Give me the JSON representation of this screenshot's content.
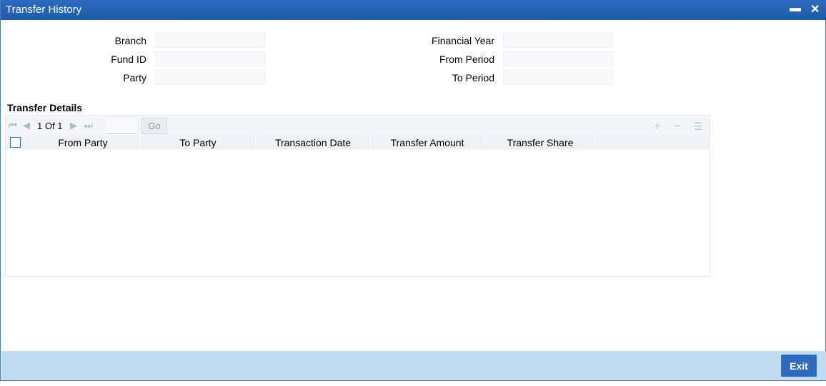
{
  "window": {
    "title": "Transfer History",
    "minimize_icon": "minimize-icon",
    "close_icon": "close-icon"
  },
  "form": {
    "branch_label": "Branch",
    "fund_id_label": "Fund ID",
    "party_label": "Party",
    "financial_year_label": "Financial Year",
    "from_period_label": "From Period",
    "to_period_label": "To Period",
    "branch_value": "",
    "fund_id_value": "",
    "party_value": "",
    "financial_year_value": "",
    "from_period_value": "",
    "to_period_value": ""
  },
  "transfer_details": {
    "title": "Transfer Details",
    "pager": {
      "current": "1",
      "of_label": "Of",
      "total": "1",
      "go_label": "Go",
      "page_input": ""
    },
    "columns": [
      "From Party",
      "To Party",
      "Transaction Date",
      "Transfer Amount",
      "Transfer Share"
    ],
    "rows": []
  },
  "footer": {
    "exit_label": "Exit"
  }
}
